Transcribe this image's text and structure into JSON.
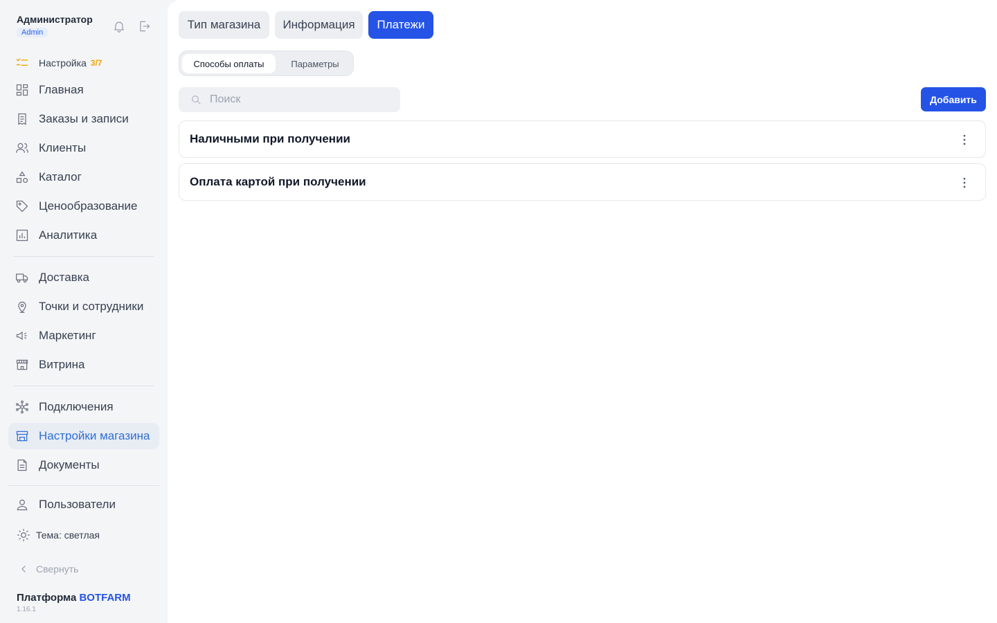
{
  "user": {
    "name": "Администратор",
    "role": "Admin"
  },
  "header_icons": [
    "bell-icon",
    "logout-icon"
  ],
  "setup": {
    "label": "Настройка",
    "count": "3/7"
  },
  "nav_group_1": [
    {
      "label": "Главная",
      "icon": "dashboard-icon"
    },
    {
      "label": "Заказы и записи",
      "icon": "receipt-icon"
    },
    {
      "label": "Клиенты",
      "icon": "users-icon"
    },
    {
      "label": "Каталог",
      "icon": "shapes-icon"
    },
    {
      "label": "Ценообразование",
      "icon": "tag-icon"
    },
    {
      "label": "Аналитика",
      "icon": "chart-icon"
    }
  ],
  "nav_group_2": [
    {
      "label": "Доставка",
      "icon": "truck-icon"
    },
    {
      "label": "Точки и сотрудники",
      "icon": "map-pin-icon"
    },
    {
      "label": "Маркетинг",
      "icon": "megaphone-icon"
    },
    {
      "label": "Витрина",
      "icon": "storefront-icon"
    }
  ],
  "nav_group_3": [
    {
      "label": "Подключения",
      "icon": "network-icon"
    },
    {
      "label": "Настройки магазина",
      "icon": "store-settings-icon",
      "active": true
    },
    {
      "label": "Документы",
      "icon": "document-icon"
    }
  ],
  "users_item": {
    "label": "Пользователи",
    "icon": "user-icon"
  },
  "theme_item": {
    "label": "Тема: светлая",
    "icon": "sun-icon"
  },
  "collapse": {
    "label": "Свернуть"
  },
  "footer": {
    "platform_prefix": "Платформа",
    "brand": "BOTFARM",
    "version": "1.16.1"
  },
  "tabs": [
    {
      "label": "Тип магазина",
      "active": false
    },
    {
      "label": "Информация",
      "active": false
    },
    {
      "label": "Платежи",
      "active": true
    }
  ],
  "subtabs": [
    {
      "label": "Способы оплаты",
      "active": true
    },
    {
      "label": "Параметры",
      "active": false
    }
  ],
  "search": {
    "placeholder": "Поиск",
    "value": ""
  },
  "add_button": {
    "label": "Добавить"
  },
  "payment_methods": [
    {
      "title": "Наличными при получении"
    },
    {
      "title": "Оплата картой при получении"
    }
  ],
  "colors": {
    "accent": "#2453e6",
    "active_nav_text": "#2f6fd6",
    "setup_count": "#f0a500"
  }
}
